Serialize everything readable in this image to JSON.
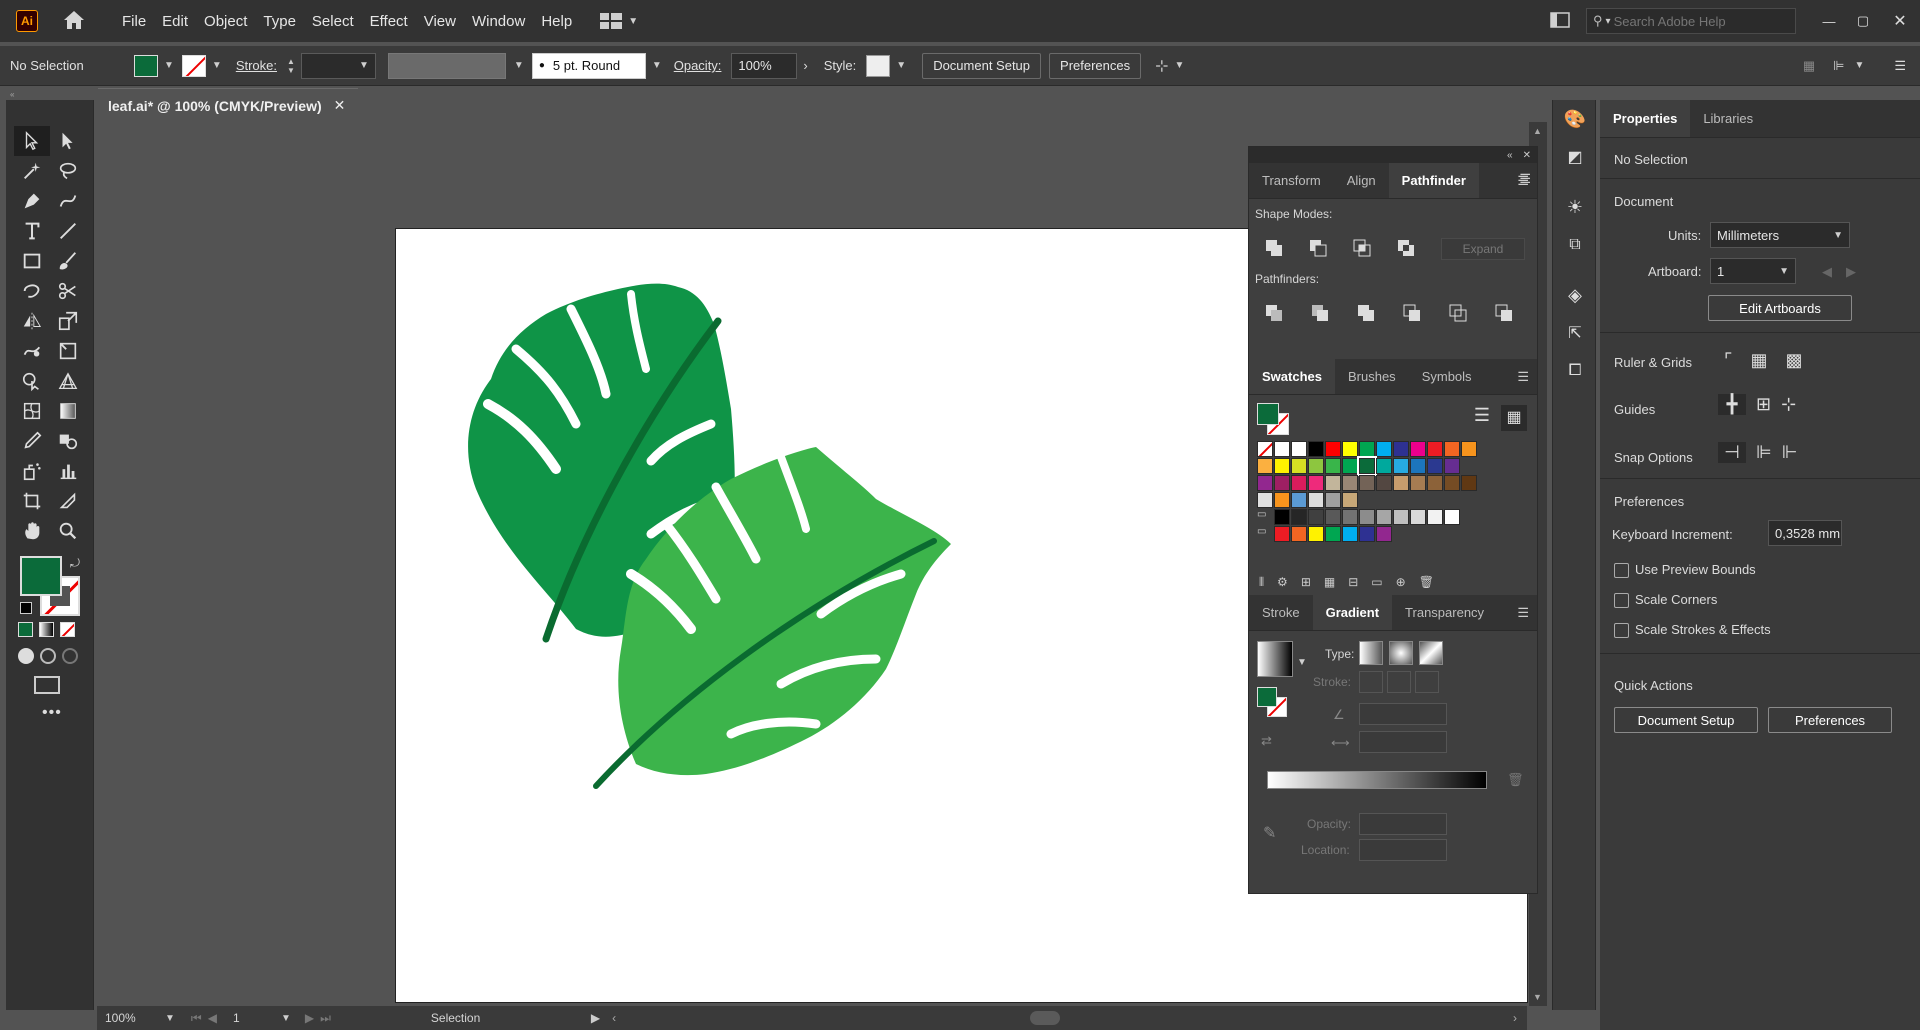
{
  "menubar": {
    "logo": "Ai",
    "items": [
      "File",
      "Edit",
      "Object",
      "Type",
      "Select",
      "Effect",
      "View",
      "Window",
      "Help"
    ],
    "search_placeholder": "Search Adobe Help"
  },
  "control": {
    "selection": "No Selection",
    "stroke_label": "Stroke:",
    "brush": "5 pt. Round",
    "opacity_label": "Opacity:",
    "opacity_value": "100%",
    "style_label": "Style:",
    "document_setup": "Document Setup",
    "preferences": "Preferences"
  },
  "doc": {
    "tab_title": "leaf.ai* @ 100% (CMYK/Preview)"
  },
  "status": {
    "zoom": "100%",
    "artboard": "1",
    "tool": "Selection"
  },
  "float_panel": {
    "tabs1": [
      "Transform",
      "Align",
      "Pathfinder"
    ],
    "shape_modes": "Shape Modes:",
    "expand": "Expand",
    "pathfinders": "Pathfinders:",
    "tabs2": [
      "Swatches",
      "Brushes",
      "Symbols"
    ],
    "tabs3": [
      "Stroke",
      "Gradient",
      "Transparency"
    ],
    "type_label": "Type:",
    "stroke_label": "Stroke:",
    "opacity_label": "Opacity:",
    "location_label": "Location:"
  },
  "properties": {
    "tabs": [
      "Properties",
      "Libraries"
    ],
    "no_selection": "No Selection",
    "document": "Document",
    "units_label": "Units:",
    "units_value": "Millimeters",
    "artboard_label": "Artboard:",
    "artboard_value": "1",
    "edit_artboards": "Edit Artboards",
    "ruler_grids": "Ruler & Grids",
    "guides": "Guides",
    "snap_options": "Snap Options",
    "preferences_title": "Preferences",
    "keyboard_increment_label": "Keyboard Increment:",
    "keyboard_increment_value": "0,3528 mm",
    "use_preview_bounds": "Use Preview Bounds",
    "scale_corners": "Scale Corners",
    "scale_strokes": "Scale Strokes & Effects",
    "quick_actions": "Quick Actions",
    "document_setup": "Document Setup",
    "preferences": "Preferences"
  },
  "colors": {
    "fill": "#0b6b3a",
    "leaf_dark": "#0f9447",
    "leaf_light": "#3cb44b",
    "vein": "#0a6b30"
  },
  "swatch_rows": [
    [
      "#ffffff",
      "#000000",
      "#ff0000",
      "#ffff00",
      "#00a651",
      "#00aeef",
      "#2e3192",
      "#ec008c",
      "#ed1c24",
      "#f26522",
      "#f7941d"
    ],
    [
      "#fbb040",
      "#fff200",
      "#d7df23",
      "#8dc63f",
      "#39b54a",
      "#00a651",
      "#0b6b3a",
      "#00a99d",
      "#27aae1",
      "#1c75bc",
      "#2b3990",
      "#662d91"
    ],
    [
      "#92278f",
      "#9e1f63",
      "#da1c5c",
      "#ee2a7b",
      "#c2b59b",
      "#998675",
      "#736357",
      "#534741",
      "#c69c6d",
      "#a67c52",
      "#8c6239",
      "#754c24",
      "#603813"
    ],
    [
      "#e0e0e0",
      "#f7941d",
      "#5b9bd5",
      "#dddddd",
      "#a0a0a0",
      "#c8a878"
    ],
    [
      "#000000",
      "#262626",
      "#404040",
      "#595959",
      "#737373",
      "#8c8c8c",
      "#a6a6a6",
      "#bfbfbf",
      "#d9d9d9",
      "#f2f2f2",
      "#ffffff"
    ],
    [
      "#ed1c24",
      "#f26522",
      "#fff200",
      "#00a651",
      "#00aeef",
      "#2e3192",
      "#92278f"
    ]
  ]
}
